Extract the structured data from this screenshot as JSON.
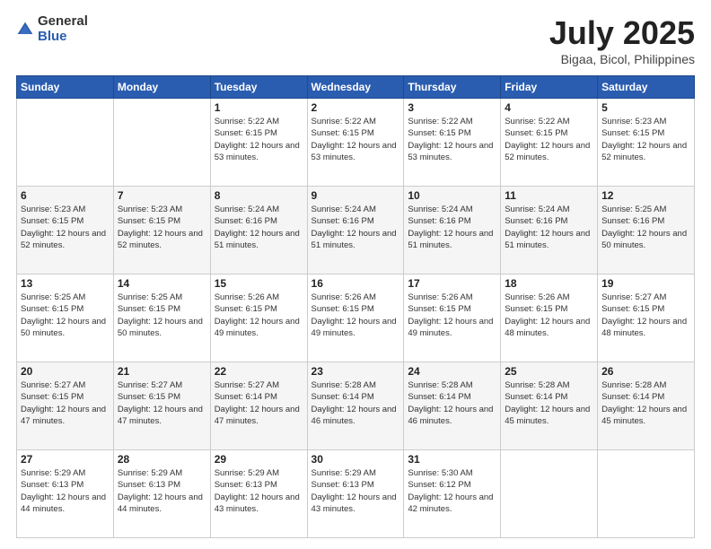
{
  "logo": {
    "general": "General",
    "blue": "Blue"
  },
  "header": {
    "title": "July 2025",
    "subtitle": "Bigaa, Bicol, Philippines"
  },
  "days_of_week": [
    "Sunday",
    "Monday",
    "Tuesday",
    "Wednesday",
    "Thursday",
    "Friday",
    "Saturday"
  ],
  "weeks": [
    [
      {
        "day": "",
        "sunrise": "",
        "sunset": "",
        "daylight": ""
      },
      {
        "day": "",
        "sunrise": "",
        "sunset": "",
        "daylight": ""
      },
      {
        "day": "1",
        "sunrise": "Sunrise: 5:22 AM",
        "sunset": "Sunset: 6:15 PM",
        "daylight": "Daylight: 12 hours and 53 minutes."
      },
      {
        "day": "2",
        "sunrise": "Sunrise: 5:22 AM",
        "sunset": "Sunset: 6:15 PM",
        "daylight": "Daylight: 12 hours and 53 minutes."
      },
      {
        "day": "3",
        "sunrise": "Sunrise: 5:22 AM",
        "sunset": "Sunset: 6:15 PM",
        "daylight": "Daylight: 12 hours and 53 minutes."
      },
      {
        "day": "4",
        "sunrise": "Sunrise: 5:22 AM",
        "sunset": "Sunset: 6:15 PM",
        "daylight": "Daylight: 12 hours and 52 minutes."
      },
      {
        "day": "5",
        "sunrise": "Sunrise: 5:23 AM",
        "sunset": "Sunset: 6:15 PM",
        "daylight": "Daylight: 12 hours and 52 minutes."
      }
    ],
    [
      {
        "day": "6",
        "sunrise": "Sunrise: 5:23 AM",
        "sunset": "Sunset: 6:15 PM",
        "daylight": "Daylight: 12 hours and 52 minutes."
      },
      {
        "day": "7",
        "sunrise": "Sunrise: 5:23 AM",
        "sunset": "Sunset: 6:15 PM",
        "daylight": "Daylight: 12 hours and 52 minutes."
      },
      {
        "day": "8",
        "sunrise": "Sunrise: 5:24 AM",
        "sunset": "Sunset: 6:16 PM",
        "daylight": "Daylight: 12 hours and 51 minutes."
      },
      {
        "day": "9",
        "sunrise": "Sunrise: 5:24 AM",
        "sunset": "Sunset: 6:16 PM",
        "daylight": "Daylight: 12 hours and 51 minutes."
      },
      {
        "day": "10",
        "sunrise": "Sunrise: 5:24 AM",
        "sunset": "Sunset: 6:16 PM",
        "daylight": "Daylight: 12 hours and 51 minutes."
      },
      {
        "day": "11",
        "sunrise": "Sunrise: 5:24 AM",
        "sunset": "Sunset: 6:16 PM",
        "daylight": "Daylight: 12 hours and 51 minutes."
      },
      {
        "day": "12",
        "sunrise": "Sunrise: 5:25 AM",
        "sunset": "Sunset: 6:16 PM",
        "daylight": "Daylight: 12 hours and 50 minutes."
      }
    ],
    [
      {
        "day": "13",
        "sunrise": "Sunrise: 5:25 AM",
        "sunset": "Sunset: 6:15 PM",
        "daylight": "Daylight: 12 hours and 50 minutes."
      },
      {
        "day": "14",
        "sunrise": "Sunrise: 5:25 AM",
        "sunset": "Sunset: 6:15 PM",
        "daylight": "Daylight: 12 hours and 50 minutes."
      },
      {
        "day": "15",
        "sunrise": "Sunrise: 5:26 AM",
        "sunset": "Sunset: 6:15 PM",
        "daylight": "Daylight: 12 hours and 49 minutes."
      },
      {
        "day": "16",
        "sunrise": "Sunrise: 5:26 AM",
        "sunset": "Sunset: 6:15 PM",
        "daylight": "Daylight: 12 hours and 49 minutes."
      },
      {
        "day": "17",
        "sunrise": "Sunrise: 5:26 AM",
        "sunset": "Sunset: 6:15 PM",
        "daylight": "Daylight: 12 hours and 49 minutes."
      },
      {
        "day": "18",
        "sunrise": "Sunrise: 5:26 AM",
        "sunset": "Sunset: 6:15 PM",
        "daylight": "Daylight: 12 hours and 48 minutes."
      },
      {
        "day": "19",
        "sunrise": "Sunrise: 5:27 AM",
        "sunset": "Sunset: 6:15 PM",
        "daylight": "Daylight: 12 hours and 48 minutes."
      }
    ],
    [
      {
        "day": "20",
        "sunrise": "Sunrise: 5:27 AM",
        "sunset": "Sunset: 6:15 PM",
        "daylight": "Daylight: 12 hours and 47 minutes."
      },
      {
        "day": "21",
        "sunrise": "Sunrise: 5:27 AM",
        "sunset": "Sunset: 6:15 PM",
        "daylight": "Daylight: 12 hours and 47 minutes."
      },
      {
        "day": "22",
        "sunrise": "Sunrise: 5:27 AM",
        "sunset": "Sunset: 6:14 PM",
        "daylight": "Daylight: 12 hours and 47 minutes."
      },
      {
        "day": "23",
        "sunrise": "Sunrise: 5:28 AM",
        "sunset": "Sunset: 6:14 PM",
        "daylight": "Daylight: 12 hours and 46 minutes."
      },
      {
        "day": "24",
        "sunrise": "Sunrise: 5:28 AM",
        "sunset": "Sunset: 6:14 PM",
        "daylight": "Daylight: 12 hours and 46 minutes."
      },
      {
        "day": "25",
        "sunrise": "Sunrise: 5:28 AM",
        "sunset": "Sunset: 6:14 PM",
        "daylight": "Daylight: 12 hours and 45 minutes."
      },
      {
        "day": "26",
        "sunrise": "Sunrise: 5:28 AM",
        "sunset": "Sunset: 6:14 PM",
        "daylight": "Daylight: 12 hours and 45 minutes."
      }
    ],
    [
      {
        "day": "27",
        "sunrise": "Sunrise: 5:29 AM",
        "sunset": "Sunset: 6:13 PM",
        "daylight": "Daylight: 12 hours and 44 minutes."
      },
      {
        "day": "28",
        "sunrise": "Sunrise: 5:29 AM",
        "sunset": "Sunset: 6:13 PM",
        "daylight": "Daylight: 12 hours and 44 minutes."
      },
      {
        "day": "29",
        "sunrise": "Sunrise: 5:29 AM",
        "sunset": "Sunset: 6:13 PM",
        "daylight": "Daylight: 12 hours and 43 minutes."
      },
      {
        "day": "30",
        "sunrise": "Sunrise: 5:29 AM",
        "sunset": "Sunset: 6:13 PM",
        "daylight": "Daylight: 12 hours and 43 minutes."
      },
      {
        "day": "31",
        "sunrise": "Sunrise: 5:30 AM",
        "sunset": "Sunset: 6:12 PM",
        "daylight": "Daylight: 12 hours and 42 minutes."
      },
      {
        "day": "",
        "sunrise": "",
        "sunset": "",
        "daylight": ""
      },
      {
        "day": "",
        "sunrise": "",
        "sunset": "",
        "daylight": ""
      }
    ]
  ]
}
